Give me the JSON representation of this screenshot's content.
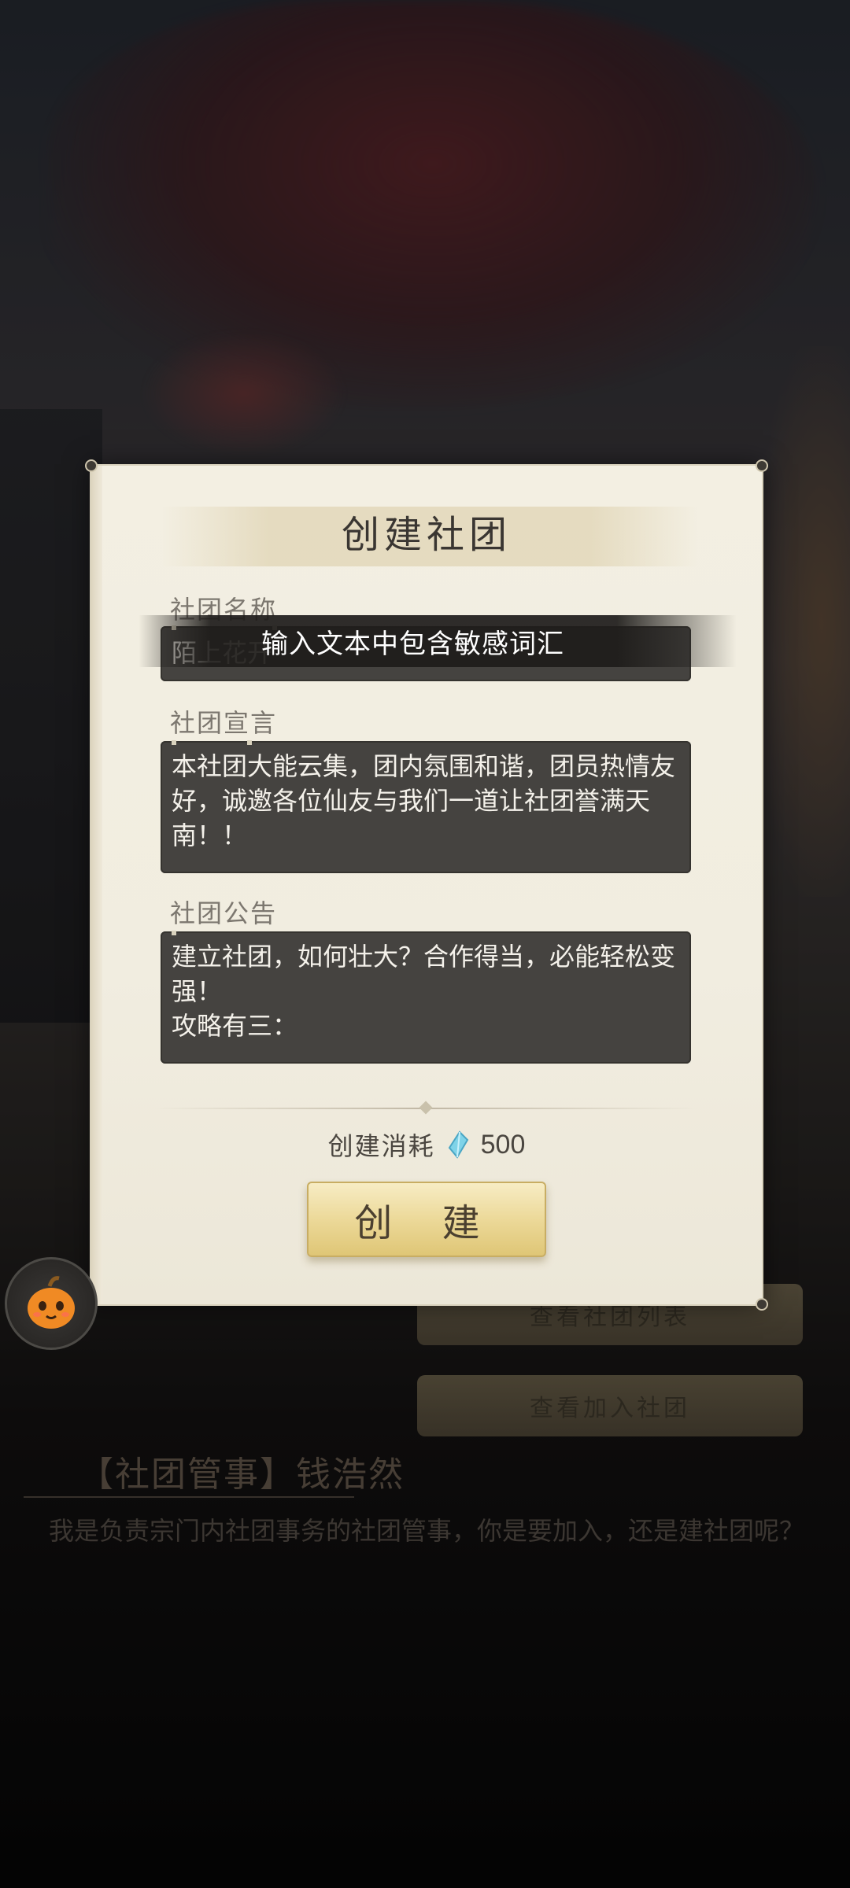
{
  "dialog": {
    "title": "创建社团",
    "fields": {
      "name": {
        "label": "社团名称",
        "value": "陌上花开"
      },
      "declaration": {
        "label": "社团宣言",
        "value": "本社团大能云集，团内氛围和谐，团员热情友好，诚邀各位仙友与我们一道让社团誉满天南！！"
      },
      "notice": {
        "label": "社团公告",
        "value_lines": [
          "建立社团，如何壮大？合作得当，必能轻松变强！",
          "攻略有三："
        ]
      }
    },
    "toast": "输入文本中包含敏感词汇",
    "cost": {
      "label": "创建消耗",
      "icon": "spirit-stone-icon",
      "value": "500"
    },
    "create_button": "创 建"
  },
  "background": {
    "buttons": [
      "查看社团列表",
      "查看加入社团"
    ],
    "npc_name": "【社团管事】钱浩然",
    "npc_text": "我是负责宗门内社团事务的社团管事，你是要加入，还是建社团呢？"
  },
  "assistant": {
    "icon": "pumpkin-mascot-icon"
  },
  "colors": {
    "dialog_bg": "#f3efe2",
    "field_bg": "#454340",
    "button_gold": "#ecd999",
    "gem_blue": "#7fd3e8"
  }
}
